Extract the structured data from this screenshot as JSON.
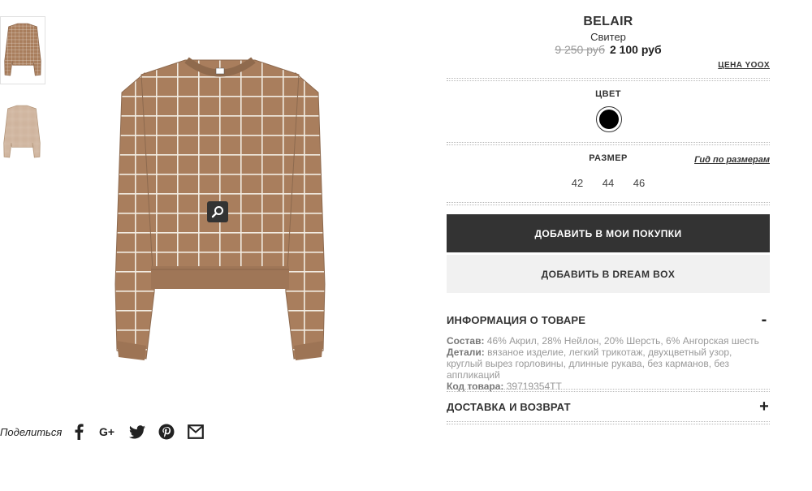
{
  "product": {
    "brand": "BELAIR",
    "category": "Свитер",
    "old_price": "9 250 руб",
    "new_price": "2 100 руб",
    "yoox_price_label": "ЦЕНА YOOX"
  },
  "color": {
    "label": "ЦВЕТ",
    "selected_swatch": "#000000"
  },
  "size": {
    "label": "РАЗМЕР",
    "guide_link": "Гид по размерам",
    "options": [
      "42",
      "44",
      "46"
    ]
  },
  "actions": {
    "add_to_cart": "ДОБАВИТЬ В МОИ ПОКУПКИ",
    "add_to_dreambox": "ДОБАВИТЬ В DREAM BOX"
  },
  "info": {
    "title": "ИНФОРМАЦИЯ О ТОВАРЕ",
    "toggle": "-",
    "composition_label": "Состав:",
    "composition_value": "46% Акрил, 28% Нейлон, 20% Шерсть, 6% Ангорская шесть",
    "details_label": "Детали:",
    "details_value": "вязаное изделие, легкий трикотаж, двухцветный узор, круглый вырез горловины, длинные рукава, без карманов, без аппликаций",
    "code_label": "Код товара:",
    "code_value": "39719354TT"
  },
  "delivery": {
    "title": "ДОСТАВКА И ВОЗВРАТ",
    "toggle": "+"
  },
  "share": {
    "label": "Поделиться",
    "icons": [
      "facebook-icon",
      "google-plus-icon",
      "twitter-icon",
      "pinterest-icon",
      "email-icon"
    ]
  },
  "colors": {
    "sweater": "#a67c5b",
    "dark_button": "#333333",
    "light_button": "#f1f1f1"
  }
}
